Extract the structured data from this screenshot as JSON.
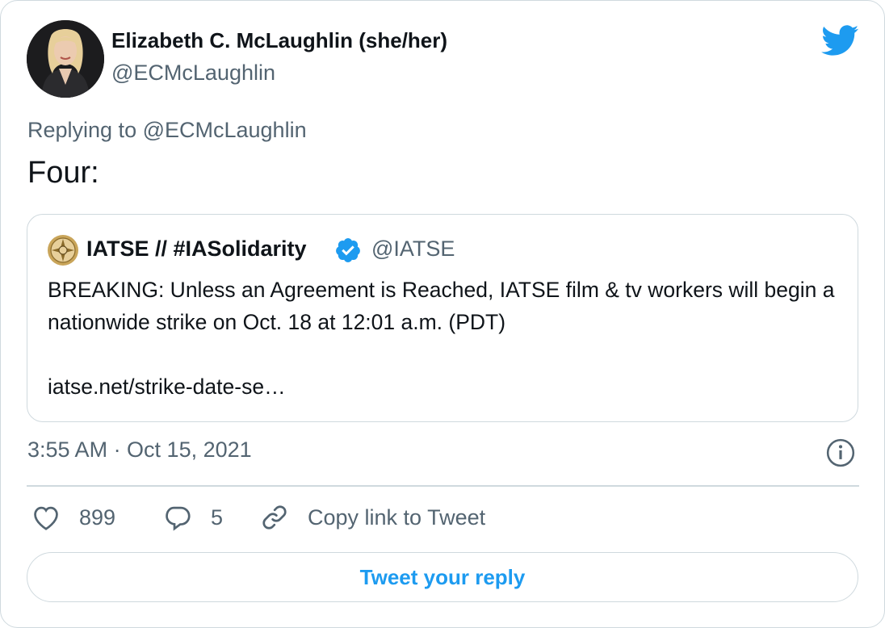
{
  "author": {
    "display_name": "Elizabeth C. McLaughlin (she/her)",
    "handle": "@ECMcLaughlin",
    "avatar_icon": "profile-photo"
  },
  "brand": {
    "icon": "twitter-bird-icon",
    "color": "#1d9bf0"
  },
  "reply_context": "Replying to @ECMcLaughlin",
  "tweet_text": "Four:",
  "quoted_tweet": {
    "display_name": "IATSE // #IASolidarity",
    "verified": true,
    "handle": "@IATSE",
    "text": "BREAKING: Unless an Agreement is Reached, IATSE film & tv workers will begin a nationwide strike on Oct. 18 at 12:01 a.m. (PDT)",
    "link": "iatse.net/strike-date-se…"
  },
  "timestamp": "3:55 AM · Oct 15, 2021",
  "actions": {
    "likes": "899",
    "replies": "5",
    "copy_link_label": "Copy link to Tweet"
  },
  "reply_button_label": "Tweet your reply",
  "colors": {
    "text_primary": "#0f1419",
    "text_secondary": "#536471",
    "border": "#cfd9de",
    "accent": "#1d9bf0"
  }
}
